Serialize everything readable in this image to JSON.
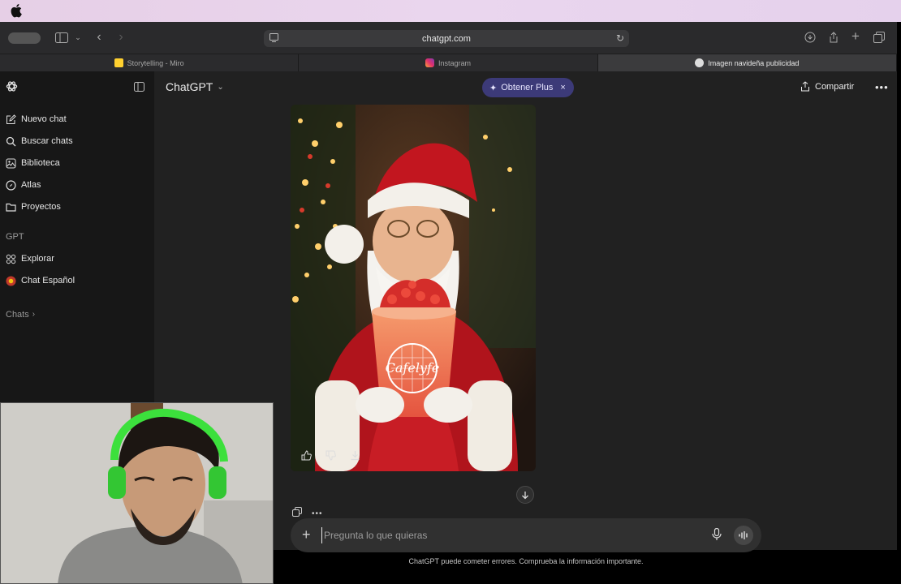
{
  "browser": {
    "url": "chatgpt.com",
    "tabs": [
      {
        "label": "Storytelling - Miro",
        "active": false
      },
      {
        "label": "Instagram",
        "active": false
      },
      {
        "label": "Imagen navideña publicidad",
        "active": true
      }
    ]
  },
  "sidebar": {
    "items": [
      {
        "label": "Nuevo chat",
        "icon": "edit-icon"
      },
      {
        "label": "Buscar chats",
        "icon": "search-icon"
      },
      {
        "label": "Biblioteca",
        "icon": "library-icon"
      },
      {
        "label": "Atlas",
        "icon": "compass-icon"
      },
      {
        "label": "Proyectos",
        "icon": "folder-icon"
      }
    ],
    "gpt_section": "GPT",
    "gpt_items": [
      {
        "label": "Explorar",
        "icon": "grid-icon"
      },
      {
        "label": "Chat Español",
        "icon": "gpt-avatar-icon"
      }
    ],
    "chats_section": "Chats"
  },
  "header": {
    "title": "ChatGPT",
    "upgrade_label": "Obtener Plus",
    "share_label": "Compartir"
  },
  "image": {
    "brand_text": "Cafelyfe"
  },
  "composer": {
    "placeholder": "Pregunta lo que quieras"
  },
  "disclaimer": "ChatGPT puede cometer errores. Comprueba la información importante.",
  "colors": {
    "sidebar_bg": "#171717",
    "main_bg": "#212121",
    "upgrade_pill_bg": "#3c3a78",
    "composer_bg": "#303030"
  }
}
